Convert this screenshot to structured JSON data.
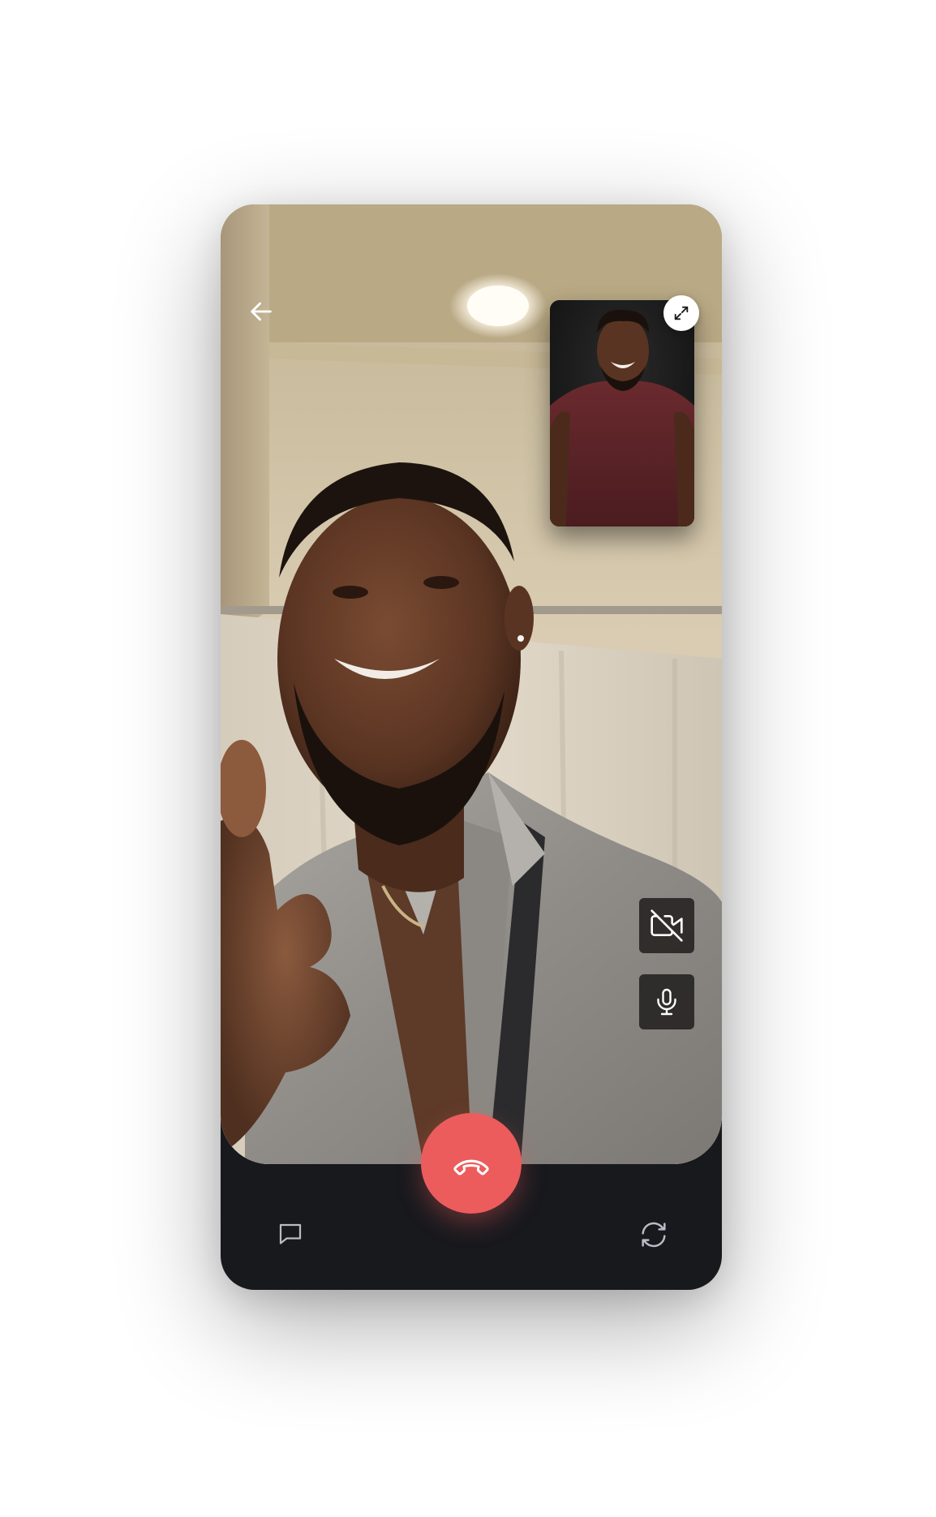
{
  "call": {
    "state": "active",
    "main_video": "remote-participant-feed",
    "pip_video": "local-camera-feed"
  },
  "controls": {
    "back_icon": "arrow-left-icon",
    "expand_icon": "expand-arrows-icon",
    "camera_icon": "video-off-icon",
    "mic_icon": "microphone-icon",
    "end_call_icon": "phone-hangup-icon",
    "chat_icon": "chat-bubble-icon",
    "switch_camera_icon": "refresh-cycle-icon"
  },
  "colors": {
    "end_call": "#ec5c5c",
    "bottom_bar": "#18191d",
    "icon_on_dark": "#ffffff",
    "icon_bottom": "#b8bcc6"
  }
}
